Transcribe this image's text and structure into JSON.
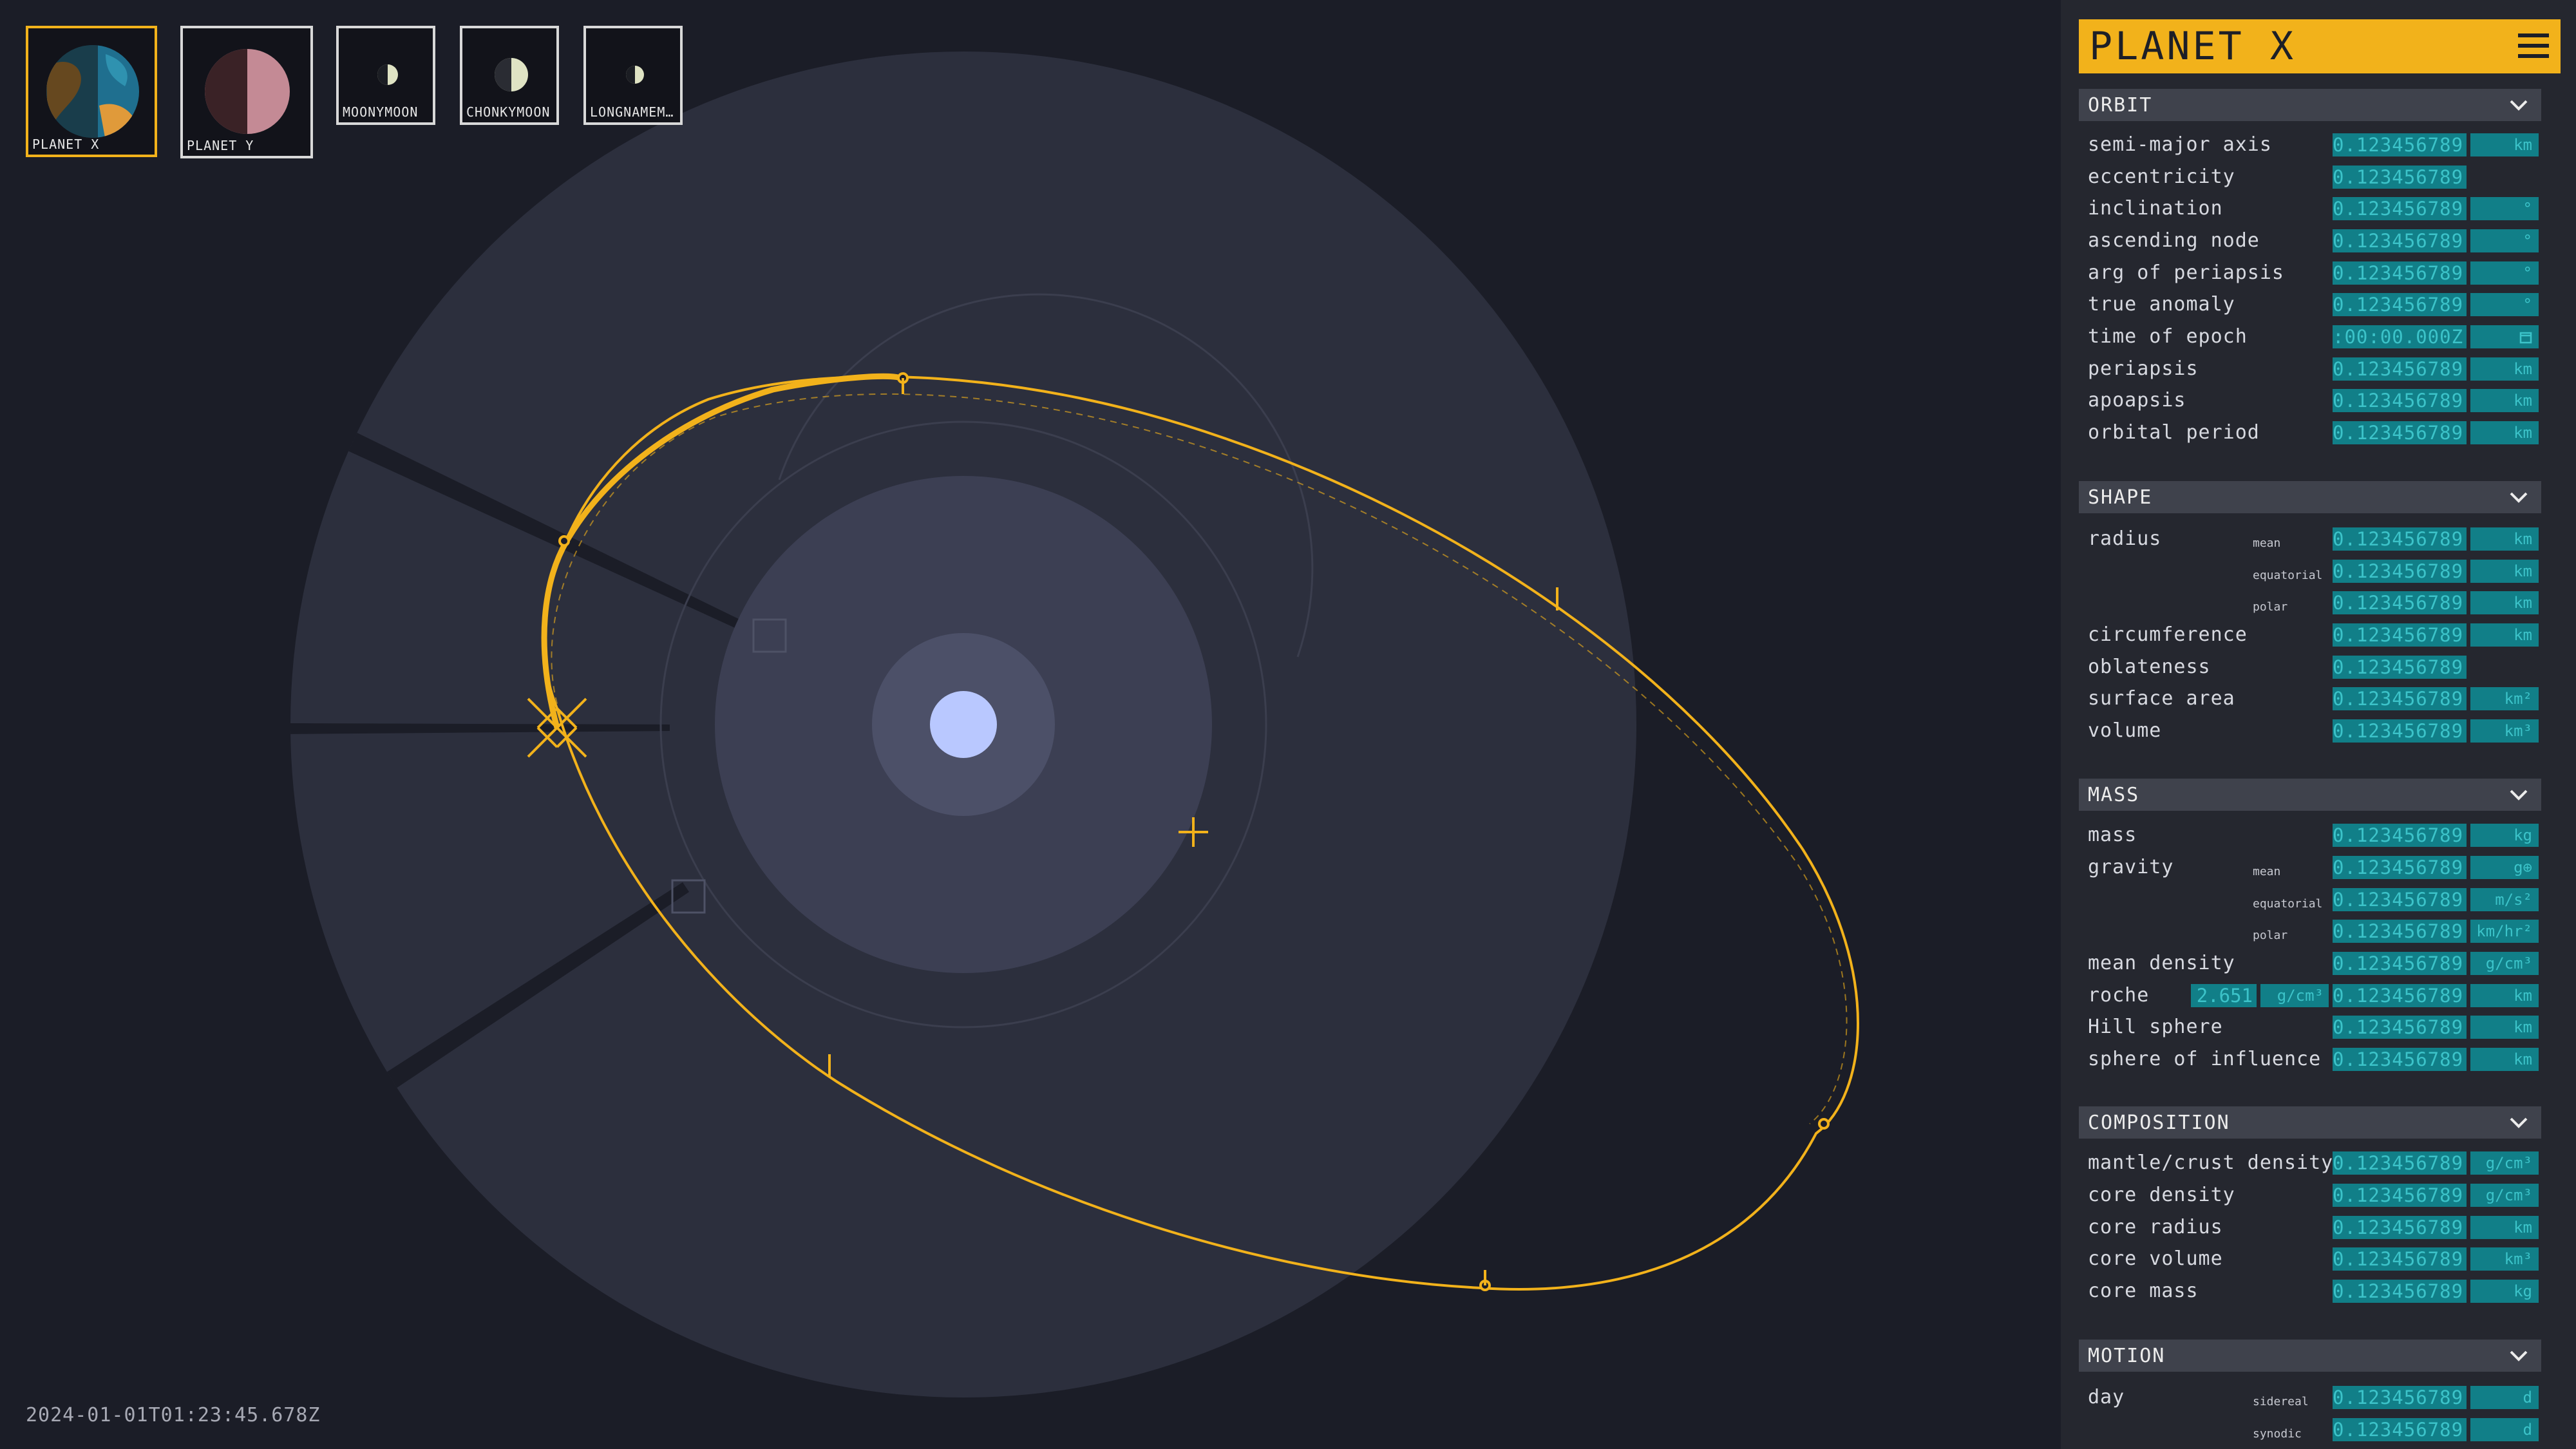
{
  "thumbnails": [
    {
      "label": "PLANET X",
      "selected": true
    },
    {
      "label": "PLANET Y",
      "selected": false
    },
    {
      "label": "MOONYMOON",
      "selected": false
    },
    {
      "label": "CHONKYMOON",
      "selected": false
    },
    {
      "label": "LONGNAMEM…",
      "selected": false
    }
  ],
  "timestamp": "2024-01-01T01:23:45.678Z",
  "colors": {
    "accent": "#f2b21b",
    "field_bg": "#117f88",
    "field_text": "#3cc3c9",
    "panel_bg": "#25272f",
    "section_bg": "#3f424c",
    "star": "#b9c8ff"
  },
  "panel": {
    "title": "PLANET X",
    "orbit": {
      "title": "ORBIT",
      "rows": {
        "semi_major_axis": {
          "label": "semi-major axis",
          "value": "0.123456789",
          "unit": "km"
        },
        "eccentricity": {
          "label": "eccentricity",
          "value": "0.123456789",
          "unit": ""
        },
        "inclination": {
          "label": "inclination",
          "value": "0.123456789",
          "unit": "°"
        },
        "ascending_node": {
          "label": "ascending node",
          "value": "0.123456789",
          "unit": "°"
        },
        "arg_periapsis": {
          "label": "arg of periapsis",
          "value": "0.123456789",
          "unit": "°"
        },
        "true_anomaly": {
          "label": "true anomaly",
          "value": "0.123456789",
          "unit": "°"
        },
        "time_of_epoch": {
          "label": "time of epoch",
          "value": ":00:00.000Z",
          "unit": "calendar-icon"
        },
        "periapsis": {
          "label": "periapsis",
          "value": "0.123456789",
          "unit": "km"
        },
        "apoapsis": {
          "label": "apoapsis",
          "value": "0.123456789",
          "unit": "km"
        },
        "orbital_period": {
          "label": "orbital period",
          "value": "0.123456789",
          "unit": "km"
        }
      }
    },
    "shape": {
      "title": "SHAPE",
      "radius": {
        "label": "radius",
        "mean": {
          "sub": "mean",
          "value": "0.123456789",
          "unit": "km"
        },
        "equatorial": {
          "sub": "equatorial",
          "value": "0.123456789",
          "unit": "km"
        },
        "polar": {
          "sub": "polar",
          "value": "0.123456789",
          "unit": "km"
        }
      },
      "circumference": {
        "label": "circumference",
        "value": "0.123456789",
        "unit": "km"
      },
      "oblateness": {
        "label": "oblateness",
        "value": "0.123456789",
        "unit": ""
      },
      "surface_area": {
        "label": "surface area",
        "value": "0.123456789",
        "unit": "km²"
      },
      "volume": {
        "label": "volume",
        "value": "0.123456789",
        "unit": "km³"
      }
    },
    "mass": {
      "title": "MASS",
      "mass": {
        "label": "mass",
        "value": "0.123456789",
        "unit": "kg"
      },
      "gravity": {
        "label": "gravity",
        "mean": {
          "sub": "mean",
          "value": "0.123456789",
          "unit": "g⊕"
        },
        "equatorial": {
          "sub": "equatorial",
          "value": "0.123456789",
          "unit": "m/s²"
        },
        "polar": {
          "sub": "polar",
          "value": "0.123456789",
          "unit": "km/hr²"
        }
      },
      "mean_density": {
        "label": "mean density",
        "value": "0.123456789",
        "unit": "g/cm³"
      },
      "roche": {
        "label": "roche",
        "density_value": "2.651",
        "density_unit": "g/cm³",
        "value": "0.123456789",
        "unit": "km"
      },
      "hill_sphere": {
        "label": "Hill sphere",
        "value": "0.123456789",
        "unit": "km"
      },
      "sphere_of_influence": {
        "label": "sphere of influence",
        "value": "0.123456789",
        "unit": "km"
      }
    },
    "composition": {
      "title": "COMPOSITION",
      "rows": {
        "mantle_density": {
          "label": "mantle/crust density",
          "value": "0.123456789",
          "unit": "g/cm³"
        },
        "core_density": {
          "label": "core density",
          "value": "0.123456789",
          "unit": "g/cm³"
        },
        "core_radius": {
          "label": "core radius",
          "value": "0.123456789",
          "unit": "km"
        },
        "core_volume": {
          "label": "core volume",
          "value": "0.123456789",
          "unit": "km³"
        },
        "core_mass": {
          "label": "core mass",
          "value": "0.123456789",
          "unit": "kg"
        }
      }
    },
    "motion": {
      "title": "MOTION",
      "day": {
        "label": "day",
        "sidereal": {
          "sub": "sidereal",
          "value": "0.123456789",
          "unit": "d"
        },
        "synodic": {
          "sub": "synodic",
          "value": "0.123456789",
          "unit": "d"
        }
      }
    }
  }
}
